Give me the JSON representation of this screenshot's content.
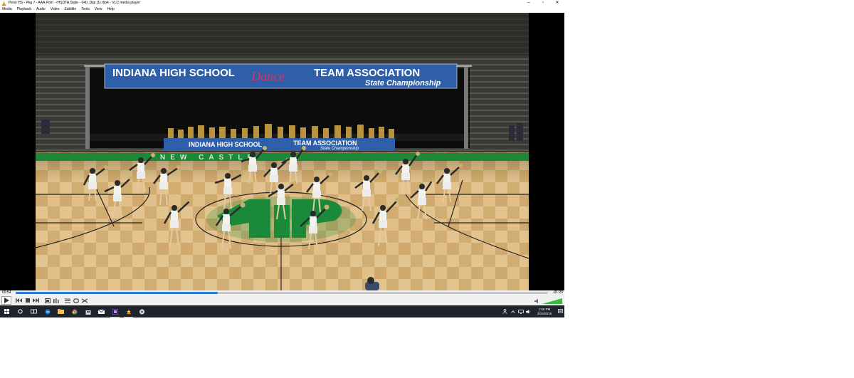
{
  "window": {
    "title": "Penn HS - Pkg 7 - AAA Pom - IHSDTA State - 040_Digi (1).mp4 - VLC media player",
    "minimize": "–",
    "maximize": "▫",
    "close": "✕"
  },
  "menu": [
    "Media",
    "Playback",
    "Audio",
    "Video",
    "Subtitle",
    "Tools",
    "View",
    "Help"
  ],
  "video": {
    "banner_line1a": "INDIANA HIGH SCHOOL",
    "banner_logo": "Dance",
    "banner_line1b": "TEAM ASSOCIATION",
    "banner_line2": "State Championship",
    "table_line1": "INDIANA HIGH SCHOOL",
    "table_line2": "TEAM ASSOCIATION",
    "table_line3": "State Championship",
    "floor_text": "NEW CASTLE"
  },
  "player": {
    "elapsed": "00:54",
    "remaining": "-01:29",
    "progress_percent": 38,
    "volume_percent": 100
  },
  "clock": {
    "time": "1:00 PM",
    "date": "3/15/2018"
  },
  "colors": {
    "accent": "#2f7fd8",
    "taskbar": "#1d2430",
    "court_green": "#1a8a3a",
    "banner_blue": "#2f5fa8"
  }
}
